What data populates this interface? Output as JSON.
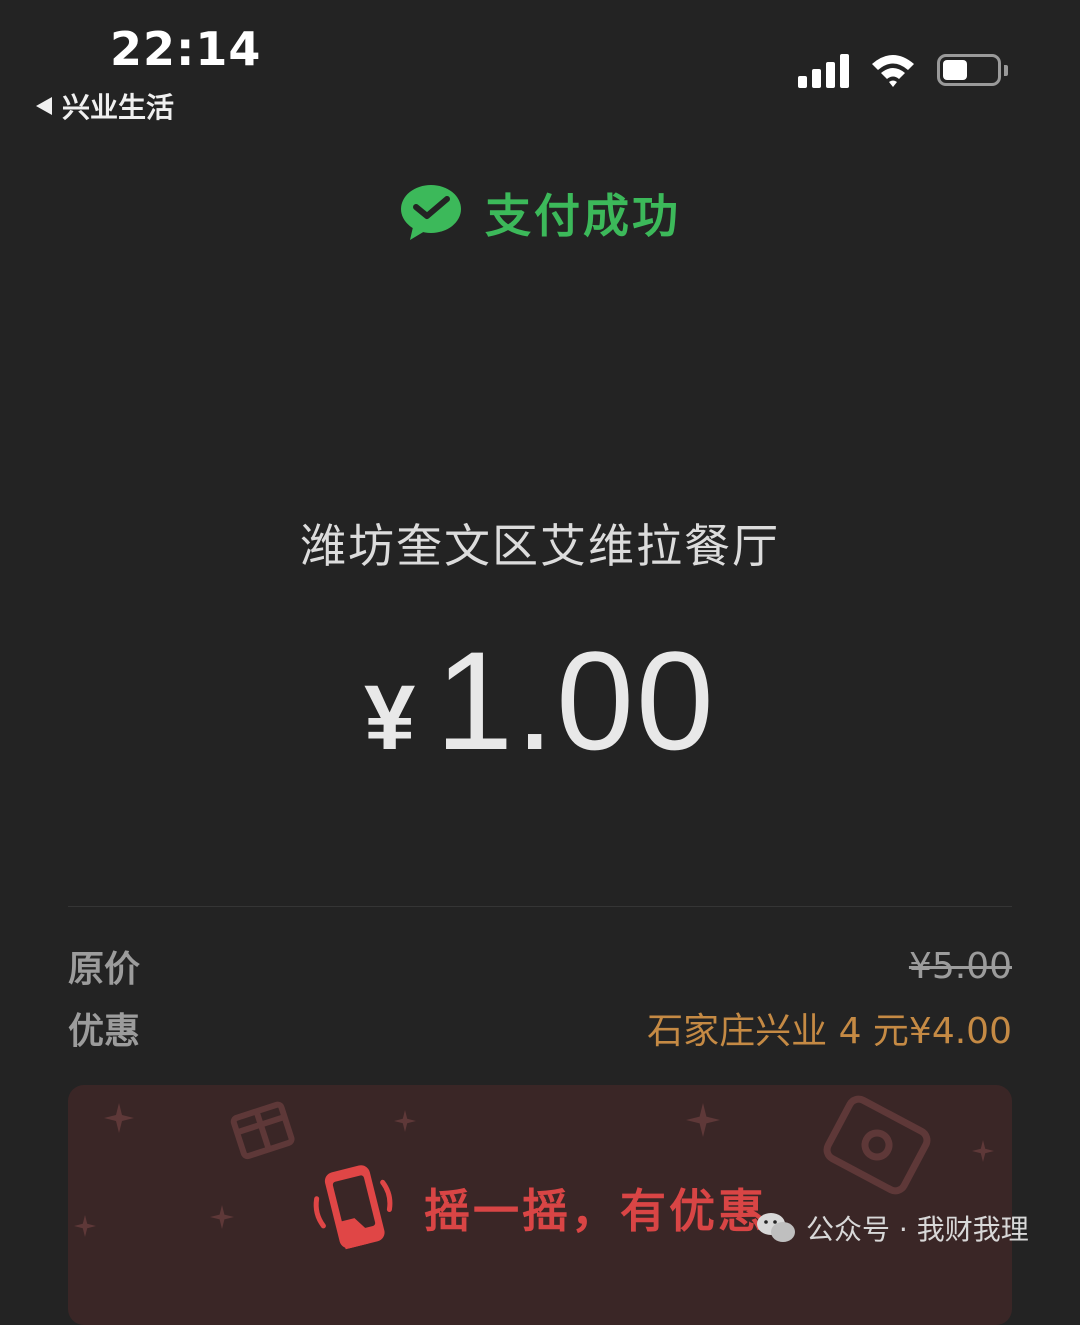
{
  "status_bar": {
    "time": "22:14",
    "back_app": "兴业生活",
    "icons": [
      "signal-icon",
      "wifi-icon",
      "battery-icon"
    ]
  },
  "header": {
    "title": "支付成功",
    "icon": "wechat-pay-check-icon",
    "color": "#3cb95a"
  },
  "payment": {
    "merchant": "潍坊奎文区艾维拉餐厅",
    "currency_symbol": "¥",
    "amount": "1.00"
  },
  "details": {
    "original_label": "原价",
    "original_value": "¥5.00",
    "discount_label": "优惠",
    "discount_value": "石家庄兴业 4 元¥4.00",
    "discount_color": "#c58a44"
  },
  "promo": {
    "text": "摇一摇，有优惠",
    "icon": "shake-phone-icon",
    "color": "#d94545"
  },
  "watermark": {
    "text": "公众号 · 我财我理",
    "icon": "wechat-icon"
  }
}
